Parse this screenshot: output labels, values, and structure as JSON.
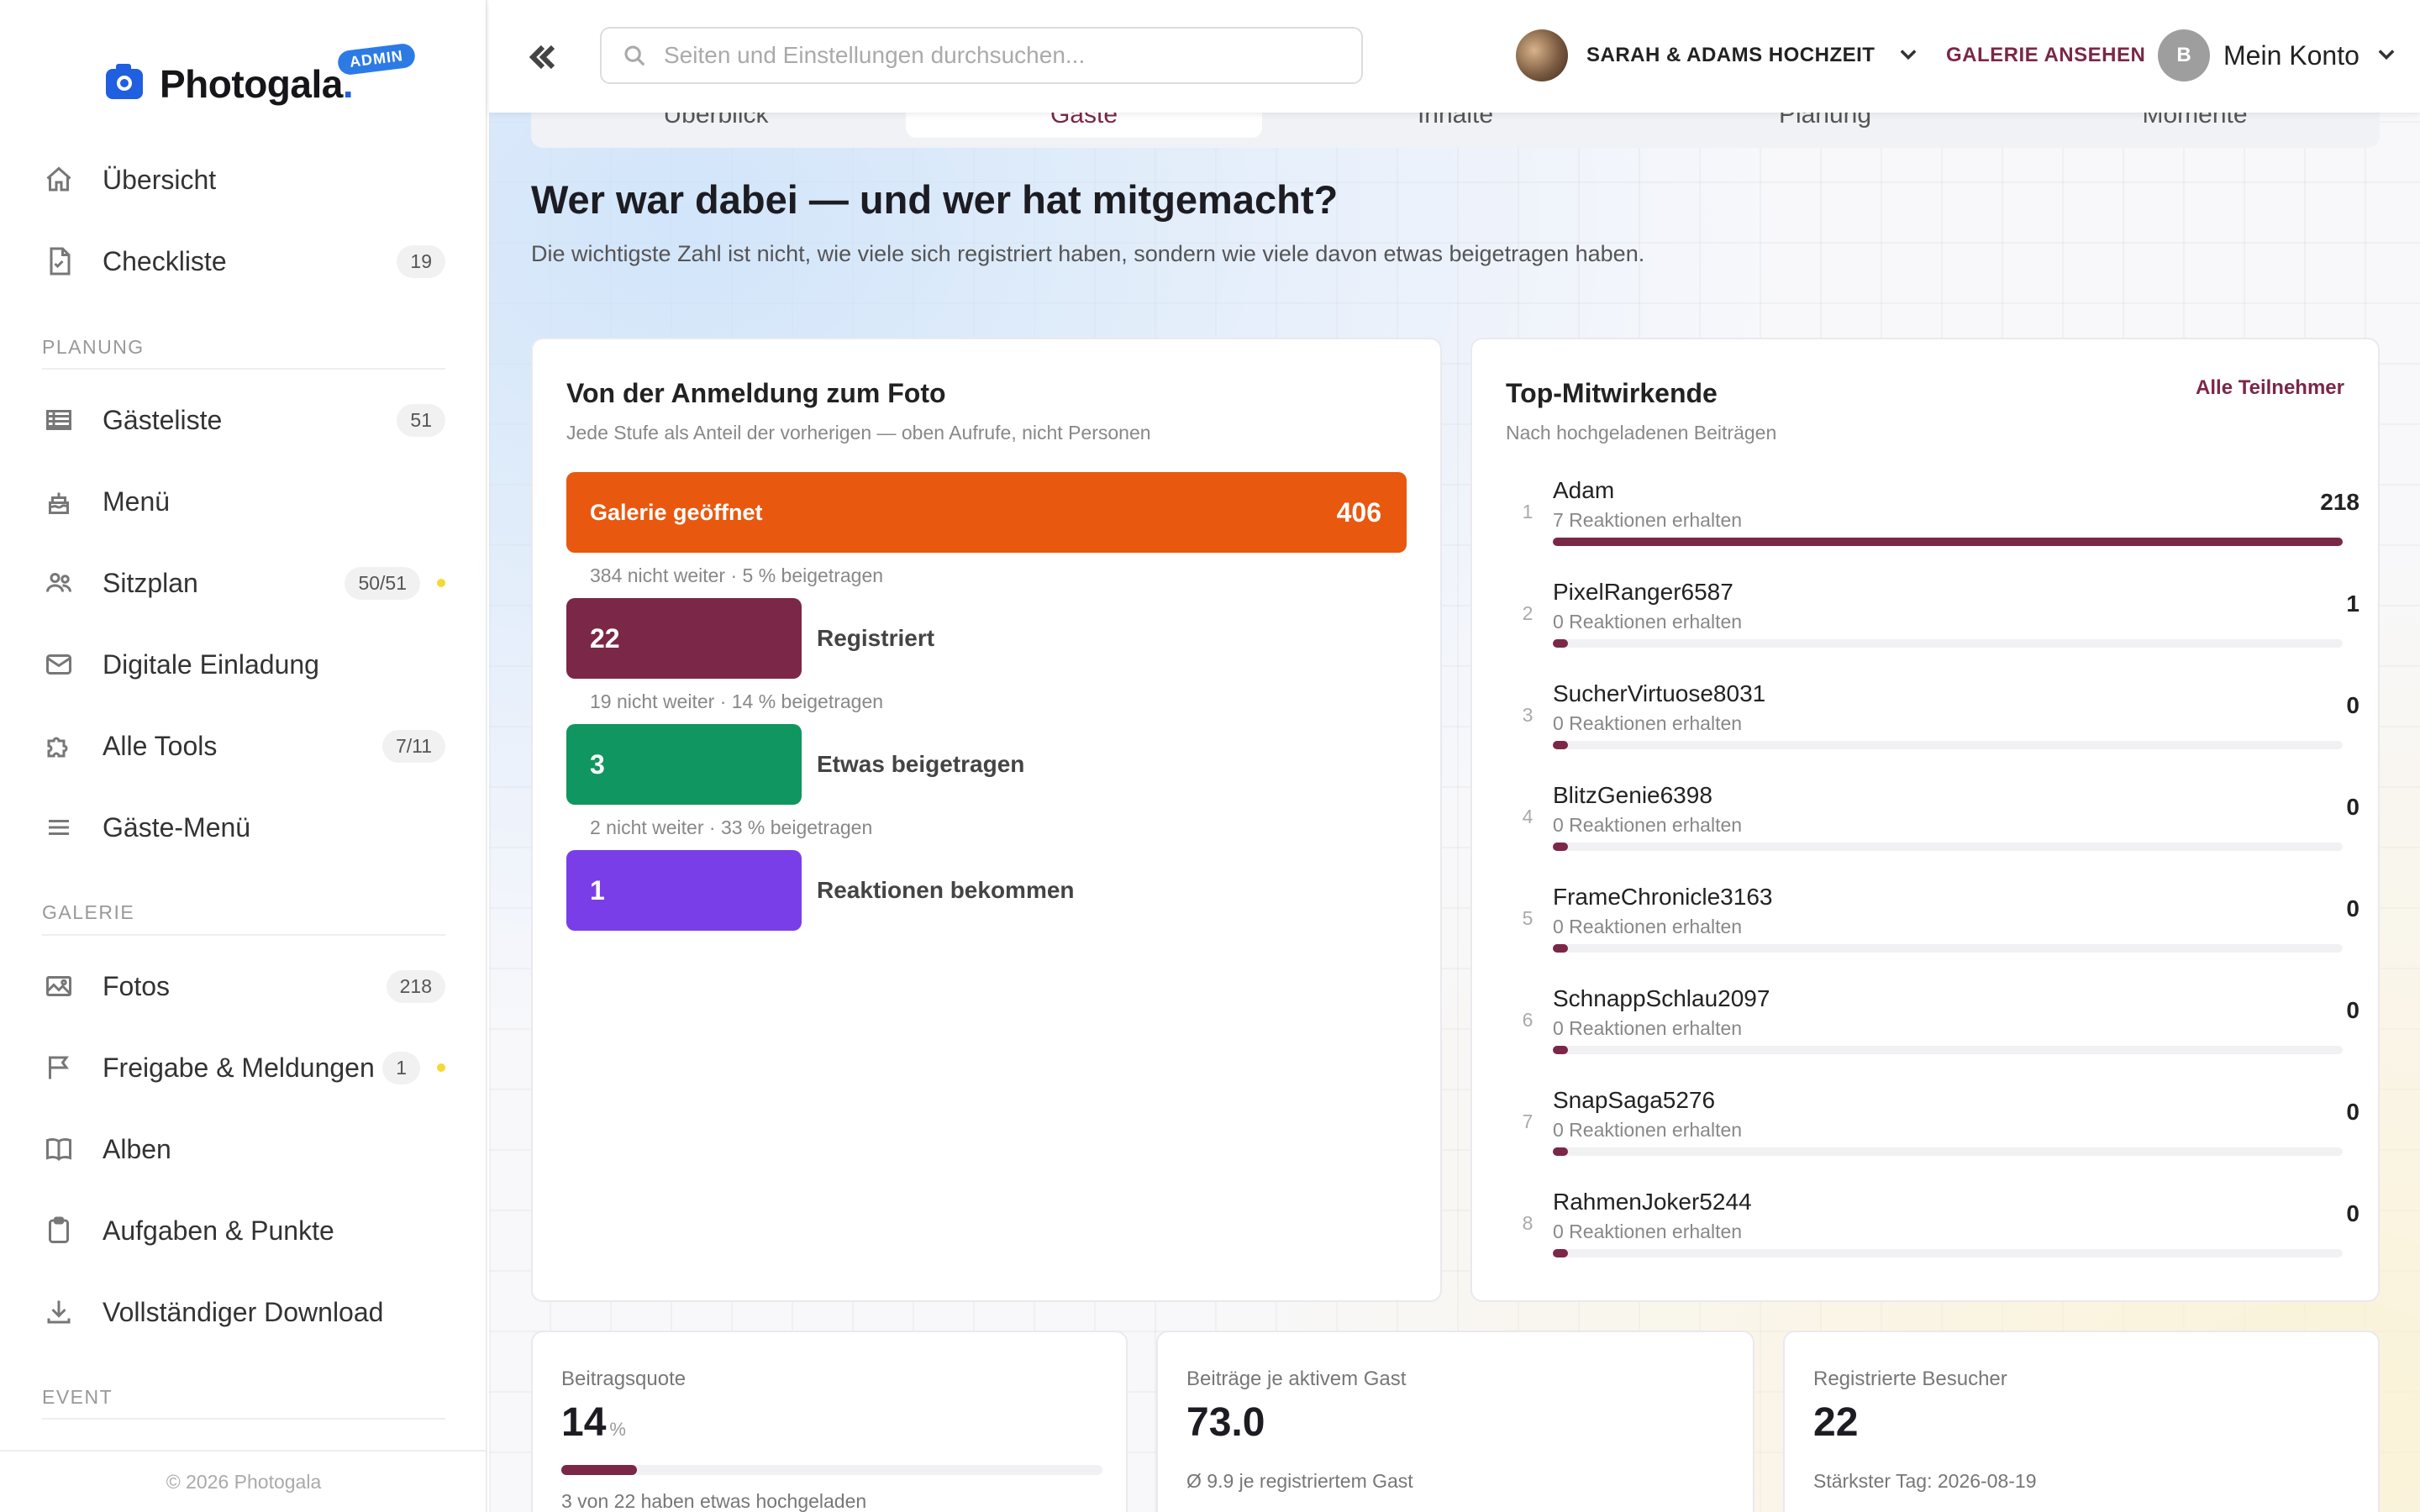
{
  "brand": {
    "name": "Photogala",
    "dot": ".",
    "badge": "ADMIN",
    "footer": "© 2026 Photogala"
  },
  "sidebar": {
    "top_items": [
      {
        "label": "Übersicht",
        "icon": "home-icon"
      },
      {
        "label": "Checkliste",
        "icon": "checklist-icon",
        "badge": "19"
      }
    ],
    "sections": [
      {
        "label": "PLANUNG",
        "items": [
          {
            "label": "Gästeliste",
            "icon": "table-icon",
            "badge": "51"
          },
          {
            "label": "Menü",
            "icon": "cake-icon"
          },
          {
            "label": "Sitzplan",
            "icon": "people-icon",
            "badge": "50/51",
            "dot": true
          },
          {
            "label": "Digitale Einladung",
            "icon": "mail-icon"
          },
          {
            "label": "Alle Tools",
            "icon": "puzzle-icon",
            "badge": "7/11"
          },
          {
            "label": "Gäste-Menü",
            "icon": "menu-lines-icon"
          }
        ]
      },
      {
        "label": "GALERIE",
        "items": [
          {
            "label": "Fotos",
            "icon": "image-icon",
            "badge": "218"
          },
          {
            "label": "Freigabe & Meldungen",
            "icon": "flag-icon",
            "badge": "1",
            "dot": true
          },
          {
            "label": "Alben",
            "icon": "book-icon"
          },
          {
            "label": "Aufgaben & Punkte",
            "icon": "clipboard-icon"
          },
          {
            "label": "Vollständiger Download",
            "icon": "download-icon"
          }
        ]
      },
      {
        "label": "EVENT",
        "items": []
      }
    ]
  },
  "topbar": {
    "search_placeholder": "Seiten und Einstellungen durchsuchen...",
    "event_name": "SARAH & ADAMS HOCHZEIT",
    "gallery_link": "GALERIE ANSEHEN",
    "account_initial": "B",
    "account_label": "Mein Konto"
  },
  "tabs": [
    {
      "label": "Überblick"
    },
    {
      "label": "Gäste",
      "active": true
    },
    {
      "label": "Inhalte"
    },
    {
      "label": "Planung"
    },
    {
      "label": "Momente"
    }
  ],
  "page": {
    "title": "Wer war dabei — und wer hat mitgemacht?",
    "subtitle": "Die wichtigste Zahl ist nicht, wie viele sich registriert haben, sondern wie viele davon etwas beigetragen haben."
  },
  "funnel": {
    "title": "Von der Anmeldung zum Foto",
    "subtitle": "Jede Stufe als Anteil der vorherigen — oben Aufrufe, nicht Personen",
    "steps": [
      {
        "label": "Galerie geöffnet",
        "value": 406,
        "color": "#e8580f"
      },
      {
        "label": "Registriert",
        "value": 22,
        "color": "#7b2748"
      },
      {
        "label": "Etwas beigetragen",
        "value": 3,
        "color": "#109660"
      },
      {
        "label": "Reaktionen bekommen",
        "value": 1,
        "color": "#7a3ee8"
      }
    ],
    "drops": [
      "384 nicht weiter · 5 % beigetragen",
      "19 nicht weiter · 14 % beigetragen",
      "2 nicht weiter · 33 % beigetragen"
    ]
  },
  "contributors": {
    "title": "Top-Mitwirkende",
    "subtitle": "Nach hochgeladenen Beiträgen",
    "link": "Alle Teilnehmer",
    "max": 218,
    "rows": [
      {
        "rank": "1",
        "name": "Adam",
        "reactions": "7 Reaktionen erhalten",
        "count": 218
      },
      {
        "rank": "2",
        "name": "PixelRanger6587",
        "reactions": "0 Reaktionen erhalten",
        "count": 1
      },
      {
        "rank": "3",
        "name": "SucherVirtuose8031",
        "reactions": "0 Reaktionen erhalten",
        "count": 0
      },
      {
        "rank": "4",
        "name": "BlitzGenie6398",
        "reactions": "0 Reaktionen erhalten",
        "count": 0
      },
      {
        "rank": "5",
        "name": "FrameChronicle3163",
        "reactions": "0 Reaktionen erhalten",
        "count": 0
      },
      {
        "rank": "6",
        "name": "SchnappSchlau2097",
        "reactions": "0 Reaktionen erhalten",
        "count": 0
      },
      {
        "rank": "7",
        "name": "SnapSaga5276",
        "reactions": "0 Reaktionen erhalten",
        "count": 0
      },
      {
        "rank": "8",
        "name": "RahmenJoker5244",
        "reactions": "0 Reaktionen erhalten",
        "count": 0
      }
    ]
  },
  "stats": [
    {
      "label": "Beitragsquote",
      "value": "14",
      "unit": "%",
      "progress": 14,
      "foot": "3 von 22 haben etwas hochgeladen"
    },
    {
      "label": "Beiträge je aktivem Gast",
      "value": "73.0",
      "foot": "Ø 9.9 je registriertem Gast"
    },
    {
      "label": "Registrierte Besucher",
      "value": "22",
      "foot": "Stärkster Tag: 2026-08-19"
    }
  ]
}
